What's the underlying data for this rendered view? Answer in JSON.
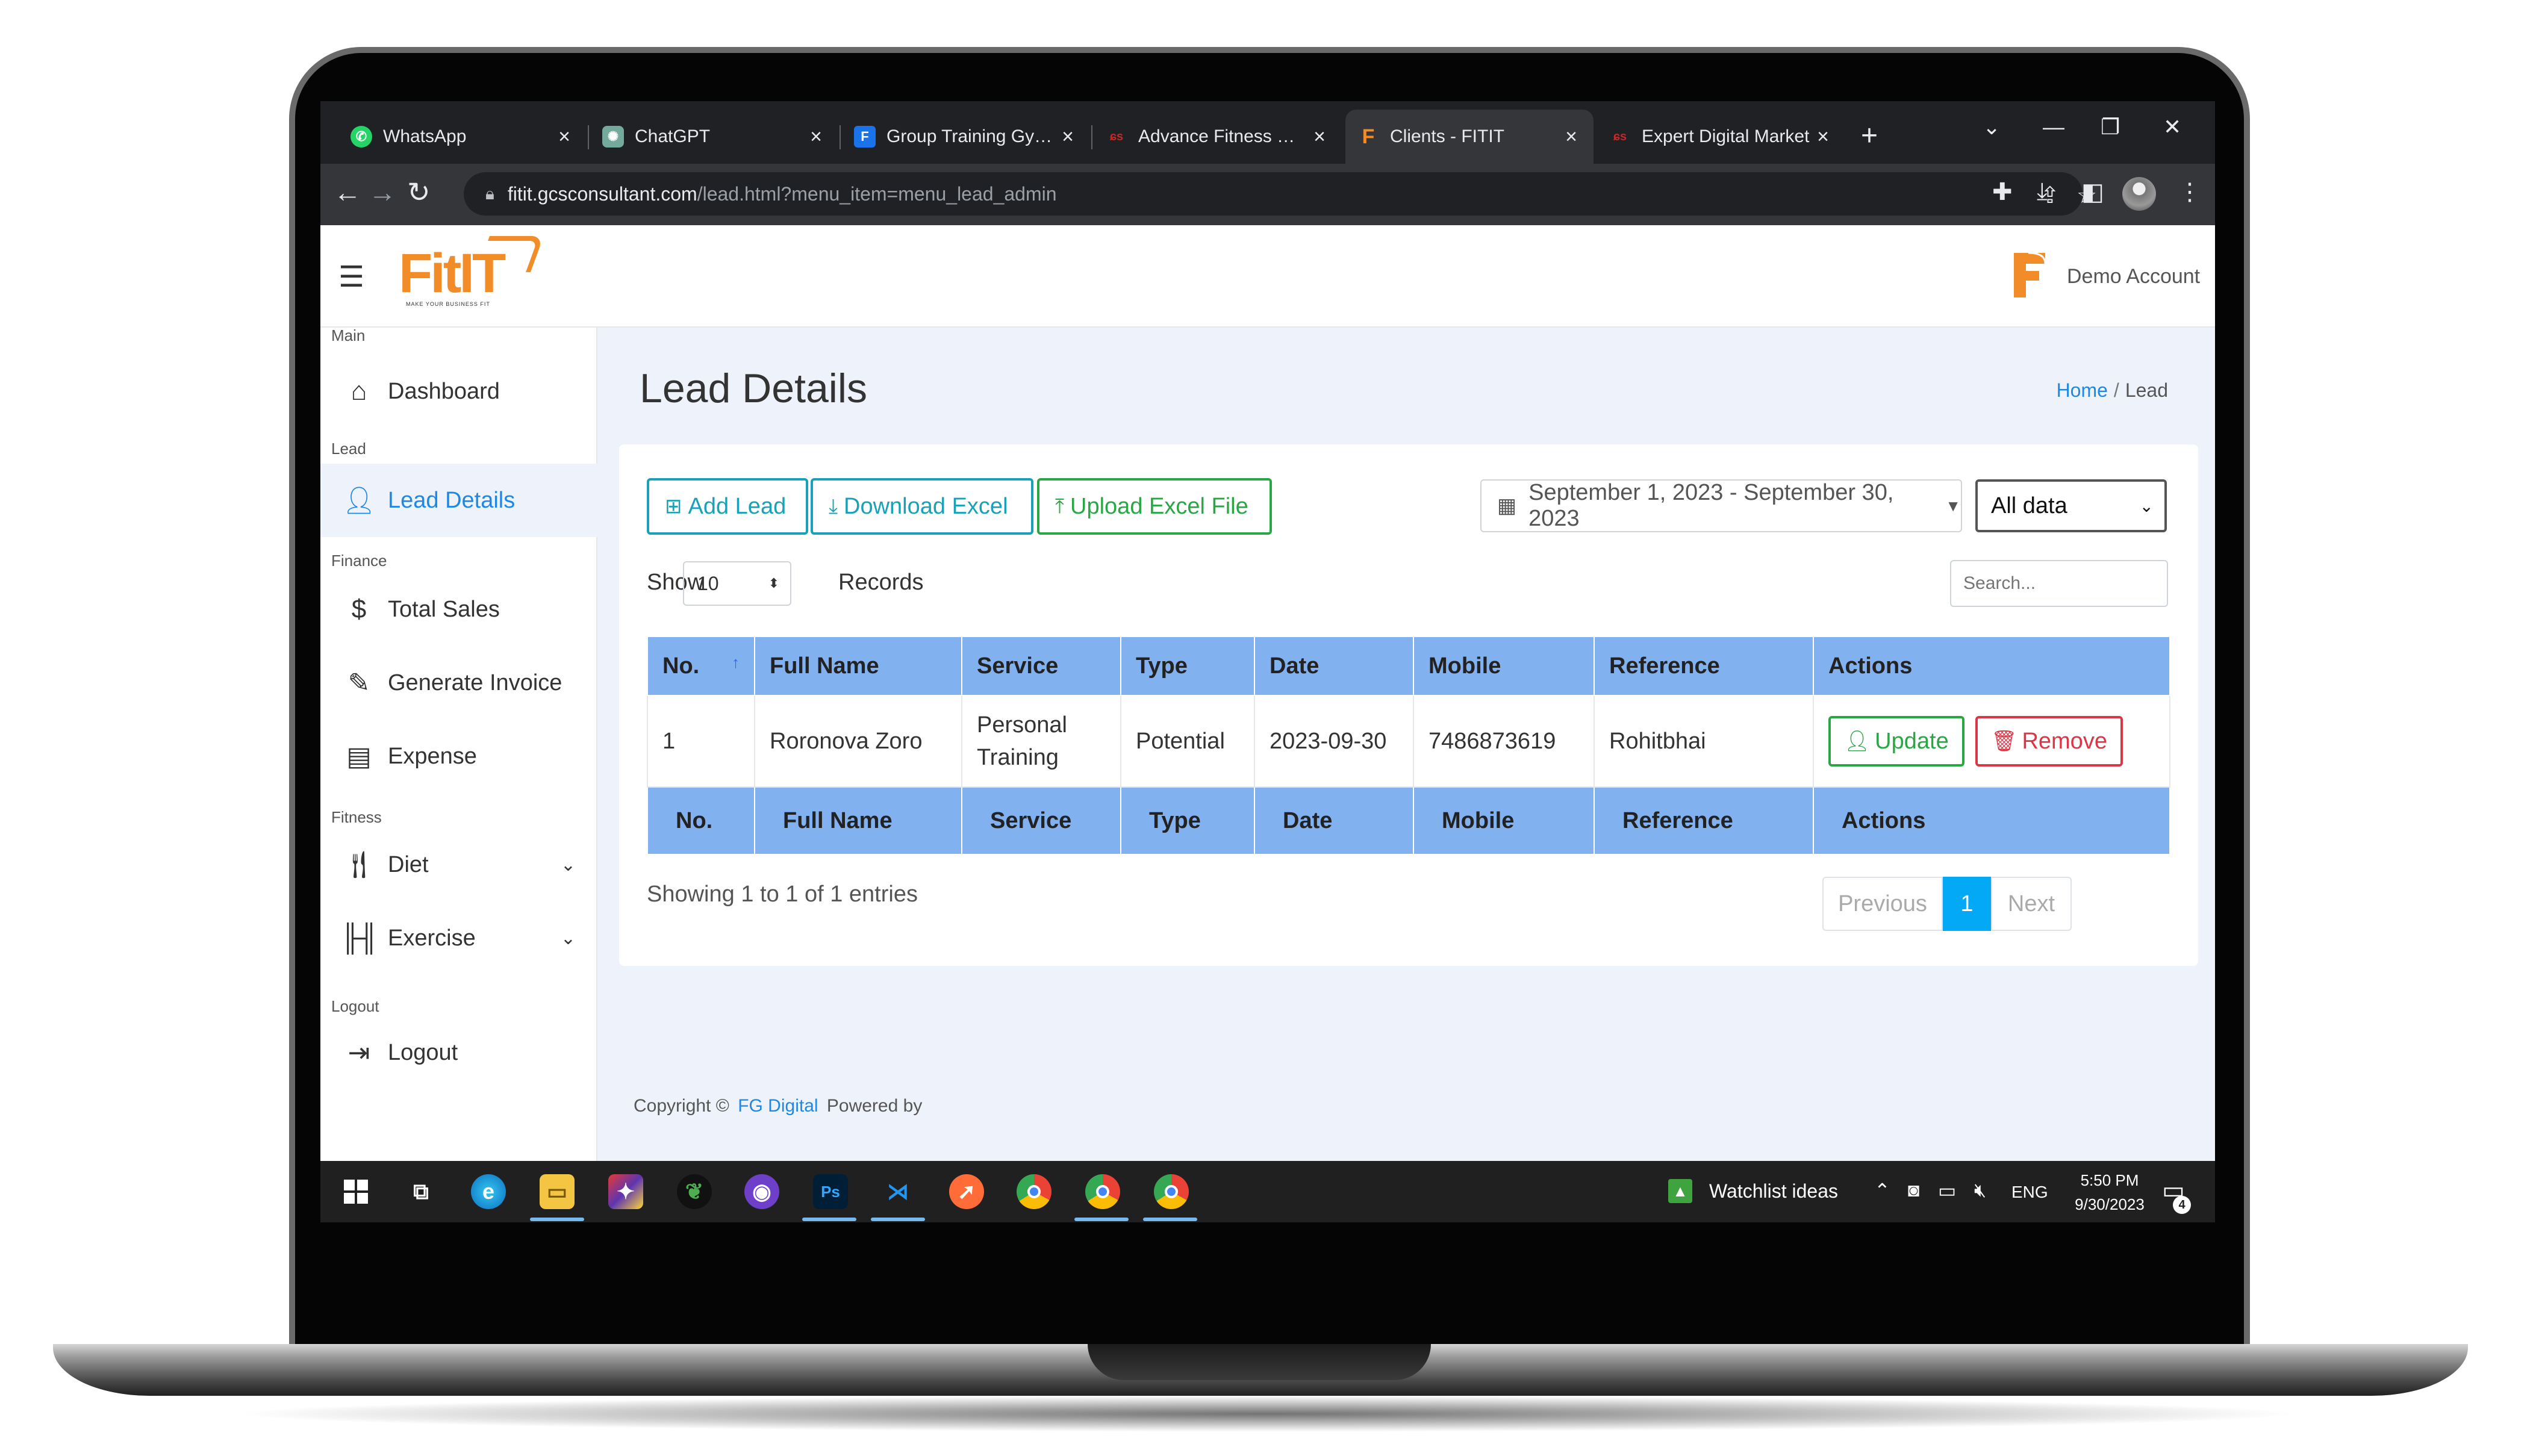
{
  "browser": {
    "tabs": [
      {
        "title": "WhatsApp",
        "icon": "whatsapp-icon",
        "color": "#25d366"
      },
      {
        "title": "ChatGPT",
        "icon": "chatgpt-icon",
        "color": "#74aa9c"
      },
      {
        "title": "Group Training Gym \\",
        "icon": "f-icon",
        "color": "#1a73e8"
      },
      {
        "title": "Advance Fitness Man",
        "icon": "gcs-icon",
        "color": "#c62828"
      },
      {
        "title": "Clients - FITIT",
        "icon": "fitit-icon",
        "color": "#f28c28",
        "active": true
      },
      {
        "title": "Expert Digital Market",
        "icon": "gcs-icon",
        "color": "#c62828"
      }
    ],
    "url_host": "fitit.gcsconsultant.com",
    "url_path": "/lead.html?menu_item=menu_lead_admin"
  },
  "header": {
    "logo_text_fit": "Fit",
    "logo_text_it": "IT",
    "logo_tagline": "MAKE YOUR BUSINESS FIT",
    "account_name": "Demo Account"
  },
  "sidebar": {
    "sections": {
      "main": "Main",
      "lead": "Lead",
      "finance": "Finance",
      "fitness": "Fitness",
      "logout": "Logout"
    },
    "items": {
      "dashboard": "Dashboard",
      "lead_details": "Lead Details",
      "total_sales": "Total Sales",
      "generate_invoice": "Generate Invoice",
      "expense": "Expense",
      "diet": "Diet",
      "exercise": "Exercise",
      "logout": "Logout"
    },
    "active_item": "lead_details"
  },
  "page": {
    "title": "Lead Details",
    "breadcrumb": {
      "home": "Home",
      "sep": "/",
      "current": "Lead"
    }
  },
  "toolbar": {
    "add_lead": "Add Lead",
    "download_excel": "Download Excel",
    "upload_excel": "Upload Excel File",
    "date_range": "September 1, 2023 - September 30, 2023",
    "data_filter": "All data"
  },
  "table_controls": {
    "show_label": "Show",
    "page_size": "10",
    "records_label": "Records",
    "search_placeholder": "Search..."
  },
  "table": {
    "columns": [
      "No.",
      "Full Name",
      "Service",
      "Type",
      "Date",
      "Mobile",
      "Reference",
      "Actions"
    ],
    "rows": [
      {
        "no": "1",
        "full_name": "Roronova Zoro",
        "service_line1": "Personal",
        "service_line2": "Training",
        "type": "Potential",
        "date": "2023-09-30",
        "mobile": "7486873619",
        "reference": "Rohitbhai",
        "update_label": "Update",
        "remove_label": "Remove"
      }
    ]
  },
  "pagination": {
    "info": "Showing 1 to 1 of 1 entries",
    "previous": "Previous",
    "current_page": "1",
    "next": "Next"
  },
  "footer": {
    "copyright": "Copyright ©",
    "company": "FG Digital",
    "powered_by": "Powered by"
  },
  "taskbar": {
    "watchlist": "Watchlist ideas",
    "language": "ENG",
    "time": "5:50 PM",
    "date": "9/30/2023",
    "notification_count": "4"
  },
  "colors": {
    "accent": "#1e88e5",
    "table_header": "#82b1f0",
    "success": "#28a745",
    "danger": "#dc3545",
    "info": "#17a2b8",
    "brand": "#f28c28"
  }
}
